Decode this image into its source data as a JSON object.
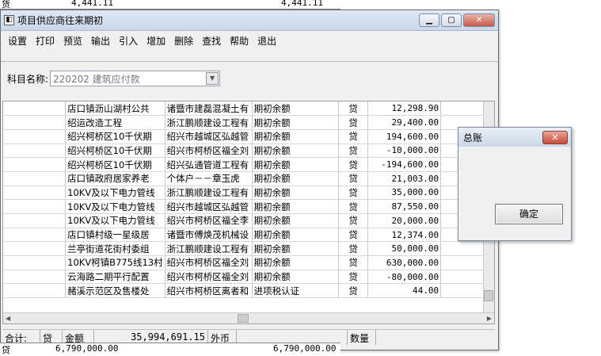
{
  "background": {
    "top_left": "货",
    "top_mid": "4,441.11",
    "top_right": "4,441.11",
    "bottom_left": "贷",
    "bottom_mid": "6,790,000.00",
    "bottom_right": "6,790,000.00"
  },
  "window": {
    "title": "项目供应商往来期初",
    "minimize": "▁",
    "maximize": "▢",
    "close": "✕",
    "icon": "◧"
  },
  "menu": [
    "设置",
    "打印",
    "预览",
    "输出",
    "引入",
    "增加",
    "删除",
    "查找",
    "帮助",
    "退出"
  ],
  "subject": {
    "label": "科目名称:",
    "value": "220202 建筑应付款"
  },
  "rows": [
    {
      "project": "店口镇沥山湖村公共",
      "supplier": "诸暨市建磊混凝土有",
      "type": "期初余额",
      "dir": "贷",
      "amount": "12,298.90"
    },
    {
      "project": "绍运改造工程",
      "supplier": "浙江鹏顺建设工程有",
      "type": "期初余额",
      "dir": "贷",
      "amount": "29,400.00"
    },
    {
      "project": "绍兴柯桥区10千伏期",
      "supplier": "绍兴市越城区弘越管",
      "type": "期初余额",
      "dir": "贷",
      "amount": "194,600.00"
    },
    {
      "project": "绍兴柯桥区10千伏期",
      "supplier": "绍兴市柯桥区福全刘",
      "type": "期初余额",
      "dir": "贷",
      "amount": "-10,000.00"
    },
    {
      "project": "绍兴柯桥区10千伏期",
      "supplier": "绍兴弘通管道工程有",
      "type": "期初余额",
      "dir": "贷",
      "amount": "-194,600.00"
    },
    {
      "project": "店口镇政府居家养老",
      "supplier": "个体户－－章玉虎",
      "type": "期初余额",
      "dir": "贷",
      "amount": "21,003.00"
    },
    {
      "project": "10KV及以下电力管线",
      "supplier": "浙江鹏顺建设工程有",
      "type": "期初余额",
      "dir": "贷",
      "amount": "35,000.00"
    },
    {
      "project": "10KV及以下电力管线",
      "supplier": "绍兴市越城区弘越管",
      "type": "期初余额",
      "dir": "贷",
      "amount": "87,550.00"
    },
    {
      "project": "10KV及以下电力管线",
      "supplier": "绍兴市柯桥区福全李",
      "type": "期初余额",
      "dir": "贷",
      "amount": "20,000.00"
    },
    {
      "project": "店口镇村级一星级居",
      "supplier": "诸暨市傅焕茂机械设",
      "type": "期初余额",
      "dir": "贷",
      "amount": "12,374.00"
    },
    {
      "project": "兰亭街道花街村委组",
      "supplier": "浙江鹏顺建设工程有",
      "type": "期初余额",
      "dir": "贷",
      "amount": "50,000.00"
    },
    {
      "project": "10KV柯镇B775线13村",
      "supplier": "绍兴市柯桥区福全刘",
      "type": "期初余额",
      "dir": "贷",
      "amount": "630,000.00"
    },
    {
      "project": "云海路二期平行配置",
      "supplier": "绍兴市柯桥区福全刘",
      "type": "期初余额",
      "dir": "贷",
      "amount": "-80,000.00"
    },
    {
      "project": "赭溪示范区及售楼处",
      "supplier": "绍兴市柯桥区离者和",
      "type": "进项税认证",
      "dir": "贷",
      "amount": "44.00"
    }
  ],
  "totals": {
    "label": "合计:",
    "dir": "贷",
    "amount_label": "金额",
    "amount": "35,994,691.15",
    "foreign_label": "外币",
    "qty_label": "数量"
  },
  "dialog": {
    "title": "总账",
    "close": "✕",
    "ok": "确定"
  }
}
